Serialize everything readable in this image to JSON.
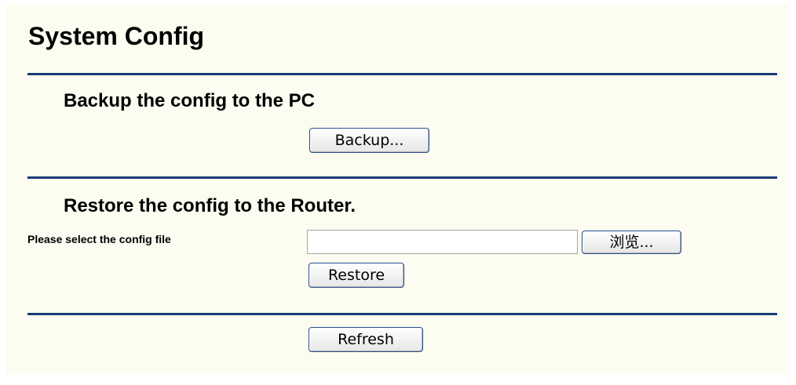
{
  "page": {
    "title": "System Config"
  },
  "backup": {
    "heading": "Backup the config to the PC",
    "button_label": "Backup..."
  },
  "restore": {
    "heading": "Restore the config to the Router.",
    "file_label": "Please select the config file",
    "file_value": "",
    "browse_label": "浏览...",
    "restore_label": "Restore"
  },
  "footer": {
    "refresh_label": "Refresh"
  },
  "colors": {
    "panel_background": "#fcfcf0",
    "divider": "#1a3a78",
    "button_border": "#2a4e8c"
  }
}
